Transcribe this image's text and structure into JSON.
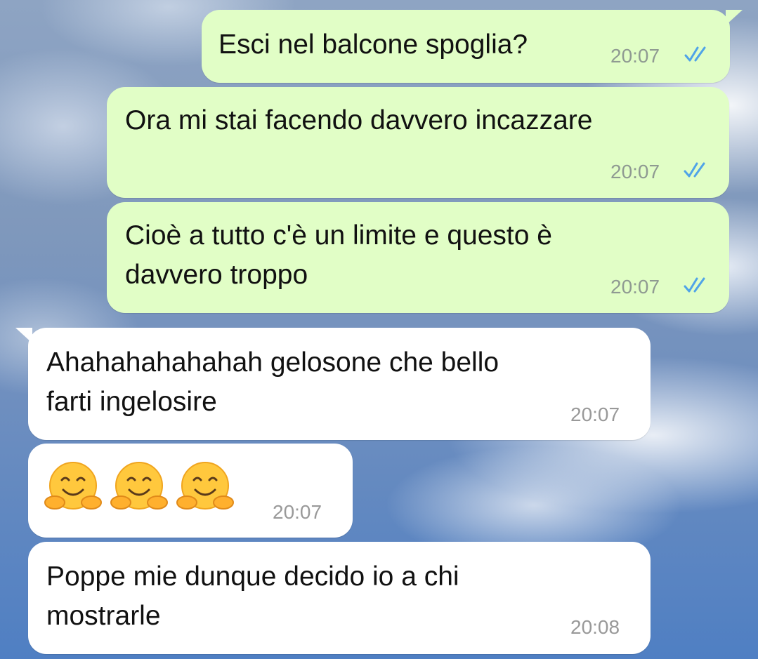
{
  "messages": [
    {
      "direction": "out",
      "text": "Esci nel balcone spoglia?",
      "time": "20:07",
      "status": "read-double-check-icon"
    },
    {
      "direction": "out",
      "text": "Ora mi stai facendo davvero incazzare",
      "time": "20:07",
      "status": "read-double-check-icon"
    },
    {
      "direction": "out",
      "text": "Cioè a tutto c'è un limite e questo è\ndavvero troppo",
      "time": "20:07",
      "status": "read-double-check-icon"
    },
    {
      "direction": "in",
      "text": "Ahahahahahahah gelosone che bello\nfarti ingelosire",
      "time": "20:07"
    },
    {
      "direction": "in",
      "emoji": [
        "hugging-face",
        "hugging-face",
        "hugging-face"
      ],
      "time": "20:07"
    },
    {
      "direction": "in",
      "text": "Poppe mie dunque decido io a chi\nmostrarle",
      "time": "20:08"
    }
  ],
  "colors": {
    "outgoing_bubble": "#e1fec6",
    "incoming_bubble": "#ffffff",
    "read_ticks": "#4fa3e8",
    "timestamp": "#8f9a92"
  }
}
